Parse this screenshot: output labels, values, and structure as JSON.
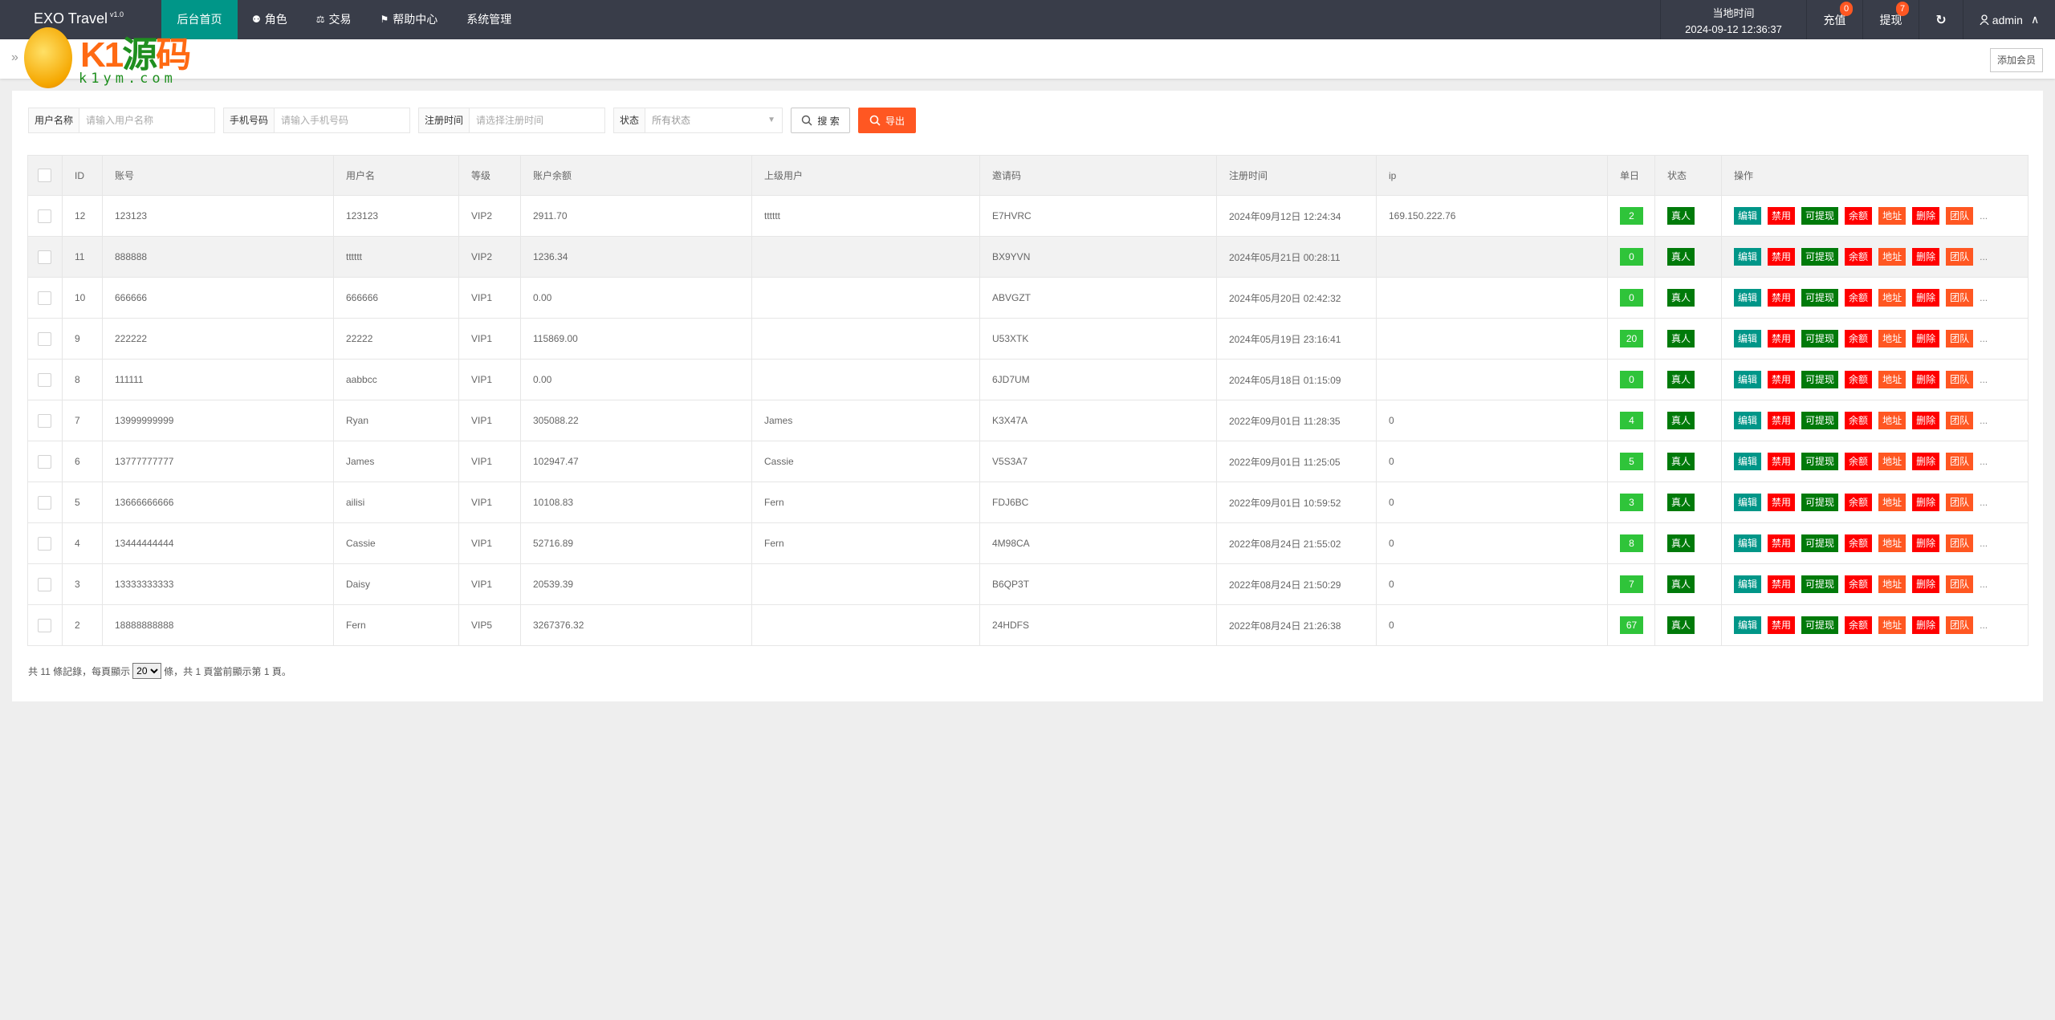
{
  "header": {
    "app_title": "EXO Travel",
    "version": "v1.0",
    "nav": [
      {
        "label": "后台首页",
        "icon": "",
        "active": true
      },
      {
        "label": "角色",
        "icon": "user-icon"
      },
      {
        "label": "交易",
        "icon": "scale-icon"
      },
      {
        "label": "帮助中心",
        "icon": "flag-icon"
      },
      {
        "label": "系统管理",
        "icon": ""
      }
    ],
    "clock_label": "当地时间",
    "clock_value": "2024-09-12 12:36:37",
    "recharge_label": "充值",
    "recharge_badge": "0",
    "withdraw_label": "提现",
    "withdraw_badge": "7",
    "refresh_icon": "refresh-icon",
    "user_label": "admin",
    "accent": "#009688"
  },
  "subbar": {
    "breadcrumb_arrow": "»",
    "add_member_label": "添加会员"
  },
  "watermark": {
    "text": "K1源码",
    "url": "k1ym.com"
  },
  "filters": {
    "username_label": "用户名称",
    "username_placeholder": "请输入用户名称",
    "phone_label": "手机号码",
    "phone_placeholder": "请输入手机号码",
    "regtime_label": "注册时间",
    "regtime_placeholder": "请选择注册时间",
    "status_label": "状态",
    "status_value": "所有状态",
    "search_label": "搜 索",
    "export_label": "导出"
  },
  "table": {
    "columns": [
      "ID",
      "账号",
      "用户名",
      "等级",
      "账户余额",
      "上级用户",
      "邀请码",
      "注册时间",
      "ip",
      "单日",
      "状态",
      "操作"
    ],
    "actions": [
      {
        "label": "编辑",
        "color": "#009688"
      },
      {
        "label": "禁用",
        "color": "#FF0000"
      },
      {
        "label": "可提现",
        "color": "#007a0a"
      },
      {
        "label": "余额",
        "color": "#FF0000"
      },
      {
        "label": "地址",
        "color": "#FF5722"
      },
      {
        "label": "删除",
        "color": "#FF0000"
      },
      {
        "label": "团队",
        "color": "#FF5722"
      }
    ],
    "more_label": "...",
    "rows": [
      {
        "id": "12",
        "account": "123123",
        "username": "123123",
        "level": "VIP2",
        "balance": "2911.70",
        "parent": "tttttt",
        "invite": "E7HVRC",
        "regtime": "2024年09月12日 12:24:34",
        "ip": "169.150.222.76",
        "daily": "2",
        "status": "真人"
      },
      {
        "id": "11",
        "account": "888888",
        "username": "tttttt",
        "level": "VIP2",
        "balance": "1236.34",
        "parent": "",
        "invite": "BX9YVN",
        "regtime": "2024年05月21日 00:28:11",
        "ip": "",
        "daily": "0",
        "status": "真人",
        "hover": true
      },
      {
        "id": "10",
        "account": "666666",
        "username": "666666",
        "level": "VIP1",
        "balance": "0.00",
        "parent": "",
        "invite": "ABVGZT",
        "regtime": "2024年05月20日 02:42:32",
        "ip": "",
        "daily": "0",
        "status": "真人"
      },
      {
        "id": "9",
        "account": "222222",
        "username": "22222",
        "level": "VIP1",
        "balance": "115869.00",
        "parent": "",
        "invite": "U53XTK",
        "regtime": "2024年05月19日 23:16:41",
        "ip": "",
        "daily": "20",
        "status": "真人"
      },
      {
        "id": "8",
        "account": "111111",
        "username": "aabbcc",
        "level": "VIP1",
        "balance": "0.00",
        "parent": "",
        "invite": "6JD7UM",
        "regtime": "2024年05月18日 01:15:09",
        "ip": "",
        "daily": "0",
        "status": "真人"
      },
      {
        "id": "7",
        "account": "13999999999",
        "username": "Ryan",
        "level": "VIP1",
        "balance": "305088.22",
        "parent": "James",
        "invite": "K3X47A",
        "regtime": "2022年09月01日 11:28:35",
        "ip": "0",
        "daily": "4",
        "status": "真人"
      },
      {
        "id": "6",
        "account": "13777777777",
        "username": "James",
        "level": "VIP1",
        "balance": "102947.47",
        "parent": "Cassie",
        "invite": "V5S3A7",
        "regtime": "2022年09月01日 11:25:05",
        "ip": "0",
        "daily": "5",
        "status": "真人"
      },
      {
        "id": "5",
        "account": "13666666666",
        "username": "ailisi",
        "level": "VIP1",
        "balance": "10108.83",
        "parent": "Fern",
        "invite": "FDJ6BC",
        "regtime": "2022年09月01日 10:59:52",
        "ip": "0",
        "daily": "3",
        "status": "真人"
      },
      {
        "id": "4",
        "account": "13444444444",
        "username": "Cassie",
        "level": "VIP1",
        "balance": "52716.89",
        "parent": "Fern",
        "invite": "4M98CA",
        "regtime": "2022年08月24日 21:55:02",
        "ip": "0",
        "daily": "8",
        "status": "真人"
      },
      {
        "id": "3",
        "account": "13333333333",
        "username": "Daisy",
        "level": "VIP1",
        "balance": "20539.39",
        "parent": "",
        "invite": "B6QP3T",
        "regtime": "2022年08月24日 21:50:29",
        "ip": "0",
        "daily": "7",
        "status": "真人"
      },
      {
        "id": "2",
        "account": "18888888888",
        "username": "Fern",
        "level": "VIP5",
        "balance": "3267376.32",
        "parent": "",
        "invite": "24HDFS",
        "regtime": "2022年08月24日 21:26:38",
        "ip": "0",
        "daily": "67",
        "status": "真人"
      }
    ]
  },
  "pager": {
    "prefix": "共 11 條記錄，每頁顯示",
    "page_size": "20",
    "suffix": "條，共 1 頁當前顯示第 1 頁。"
  }
}
